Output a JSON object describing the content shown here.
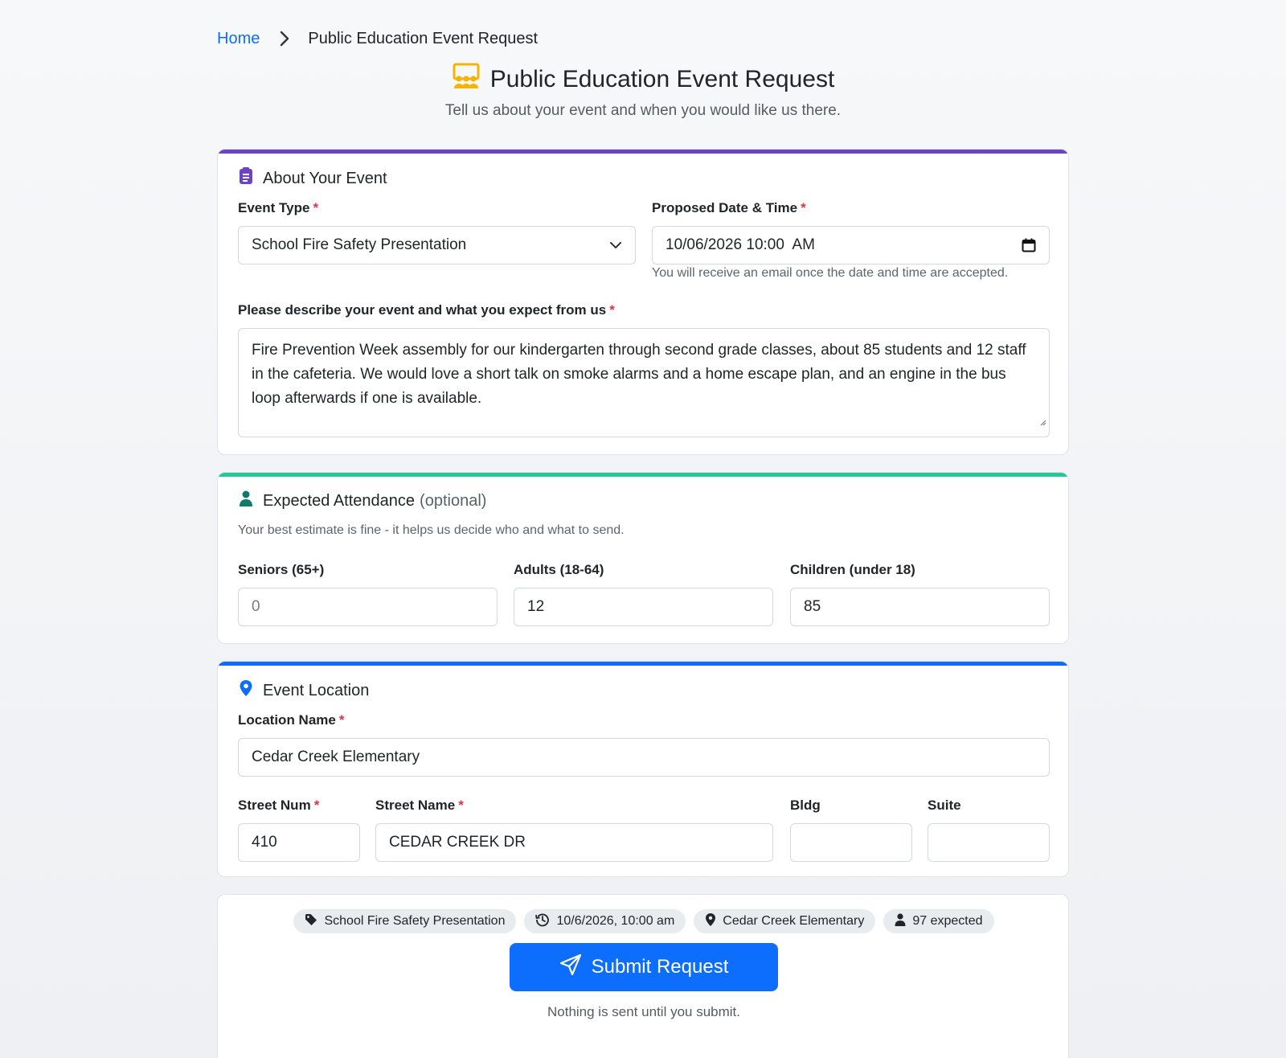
{
  "breadcrumb": {
    "home": "Home",
    "current": "Public Education Event Request"
  },
  "header": {
    "title": "Public Education Event Request",
    "subtitle": "Tell us about your event and when you would like us there.",
    "icon": "presentation-audience-icon",
    "icon_color": "#f5b400"
  },
  "about": {
    "title": "About Your Event",
    "accent": "#6f42c1",
    "event_type_label": "Event Type",
    "event_type_value": "School Fire Safety Presentation",
    "date_label": "Proposed Date & Time",
    "date_value": "10/06/2026 10:00  AM",
    "date_help": "You will receive an email once the date and time are accepted.",
    "desc_label": "Please describe your event and what you expect from us",
    "desc_value": "Fire Prevention Week assembly for our kindergarten through second grade classes, about 85 students and 12 staff in the cafeteria. We would love a short talk on smoke alarms and a home escape plan, and an engine in the bus loop afterwards if one is available.",
    "required_mark": "*"
  },
  "attendance": {
    "title": "Expected Attendance",
    "optional": "(optional)",
    "accent": "#20c997",
    "hint": "Your best estimate is fine - it helps us decide who and what to send.",
    "seniors_label": "Seniors (65+)",
    "seniors_placeholder": "0",
    "adults_label": "Adults (18-64)",
    "adults_value": "12",
    "children_label": "Children (under 18)",
    "children_value": "85"
  },
  "location": {
    "title": "Event Location",
    "accent": "#0d6efd",
    "name_label": "Location Name",
    "name_value": "Cedar Creek Elementary",
    "street_num_label": "Street Num",
    "street_num_value": "410",
    "street_name_label": "Street Name",
    "street_name_value": "CEDAR CREEK DR",
    "bldg_label": "Bldg",
    "bldg_value": "",
    "suite_label": "Suite",
    "suite_value": ""
  },
  "summary": {
    "chips": [
      {
        "icon": "tag-icon",
        "text": "School Fire Safety Presentation"
      },
      {
        "icon": "history-icon",
        "text": "10/6/2026, 10:00 am"
      },
      {
        "icon": "map-pin-icon",
        "text": "Cedar Creek Elementary"
      },
      {
        "icon": "person-icon",
        "text": "97 expected"
      }
    ],
    "submit_label": "Submit Request",
    "note": "Nothing is sent until you submit."
  }
}
